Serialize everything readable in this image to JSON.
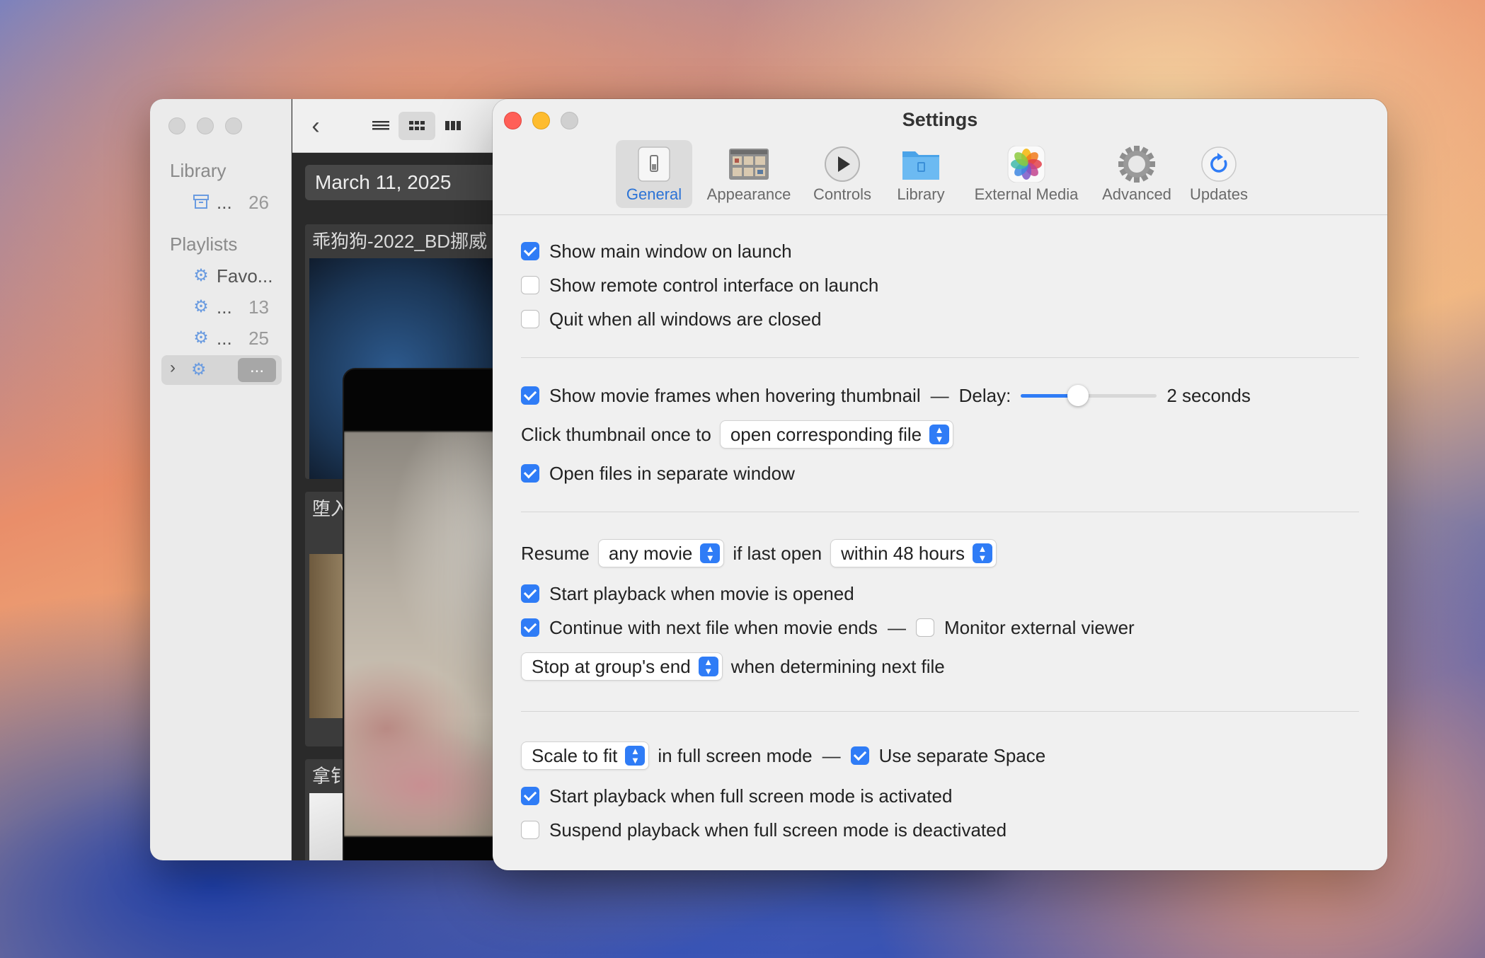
{
  "library_window": {
    "sidebar": {
      "library_heading": "Library",
      "library_item": {
        "label": "...",
        "count": "26"
      },
      "playlists_heading": "Playlists",
      "playlists": [
        {
          "label": "Favo...",
          "count": ""
        },
        {
          "label": "...",
          "count": "13"
        },
        {
          "label": "...",
          "count": "25"
        }
      ],
      "selected_item_pill": "..."
    },
    "toolbar": {
      "back_icon": "‹"
    },
    "content": {
      "date_header": "March 11, 2025",
      "thumbnails": [
        {
          "caption": "乖狗狗-2022_BD挪威"
        },
        {
          "caption": "堕入"
        },
        {
          "caption": "拿钅"
        }
      ]
    }
  },
  "settings": {
    "title": "Settings",
    "tabs": [
      {
        "label": "General",
        "icon": "switch-icon",
        "active": true
      },
      {
        "label": "Appearance",
        "icon": "grid-icon",
        "active": false
      },
      {
        "label": "Controls",
        "icon": "play-icon",
        "active": false
      },
      {
        "label": "Library",
        "icon": "folder-icon",
        "active": false
      },
      {
        "label": "External Media",
        "icon": "photos-icon",
        "active": false
      },
      {
        "label": "Advanced",
        "icon": "gear-icon",
        "active": false
      },
      {
        "label": "Updates",
        "icon": "refresh-icon",
        "active": false
      }
    ],
    "launch": {
      "show_main_window": {
        "label": "Show main window on launch",
        "checked": true
      },
      "show_remote_control": {
        "label": "Show remote control interface on launch",
        "checked": false
      },
      "quit_when_closed": {
        "label": "Quit when all windows are closed",
        "checked": false
      }
    },
    "thumbnails": {
      "show_frames": {
        "label": "Show movie frames when hovering thumbnail",
        "checked": true
      },
      "dash": "—",
      "delay_label": "Delay:",
      "delay_fraction": 0.41,
      "delay_value": "2 seconds",
      "click_label": "Click thumbnail once to",
      "click_value": "open corresponding file",
      "separate_window": {
        "label": "Open files in separate window",
        "checked": true
      }
    },
    "playback": {
      "resume_label": "Resume",
      "resume_value": "any movie",
      "if_last_open_label": "if last open",
      "within_value": "within 48 hours",
      "start_on_open": {
        "label": "Start playback when movie is opened",
        "checked": true
      },
      "continue_next": {
        "label": "Continue with next file when movie ends",
        "checked": true
      },
      "dash": "—",
      "monitor_external": {
        "label": "Monitor external viewer",
        "checked": false
      },
      "stop_value": "Stop at group's end",
      "stop_suffix": "when determining next file"
    },
    "fullscreen": {
      "scale_value": "Scale to fit",
      "scale_suffix": "in full screen mode",
      "dash": "—",
      "separate_space": {
        "label": "Use separate Space",
        "checked": true
      },
      "start_on_fullscreen": {
        "label": "Start playback when full screen mode is activated",
        "checked": true
      },
      "suspend_on_exit": {
        "label": "Suspend playback when full screen mode is deactivated",
        "checked": false
      }
    }
  },
  "colors": {
    "accent": "#2f7cf6",
    "close": "#ff5f57",
    "minimize": "#febc2e",
    "inactive": "#d0d0d0"
  }
}
